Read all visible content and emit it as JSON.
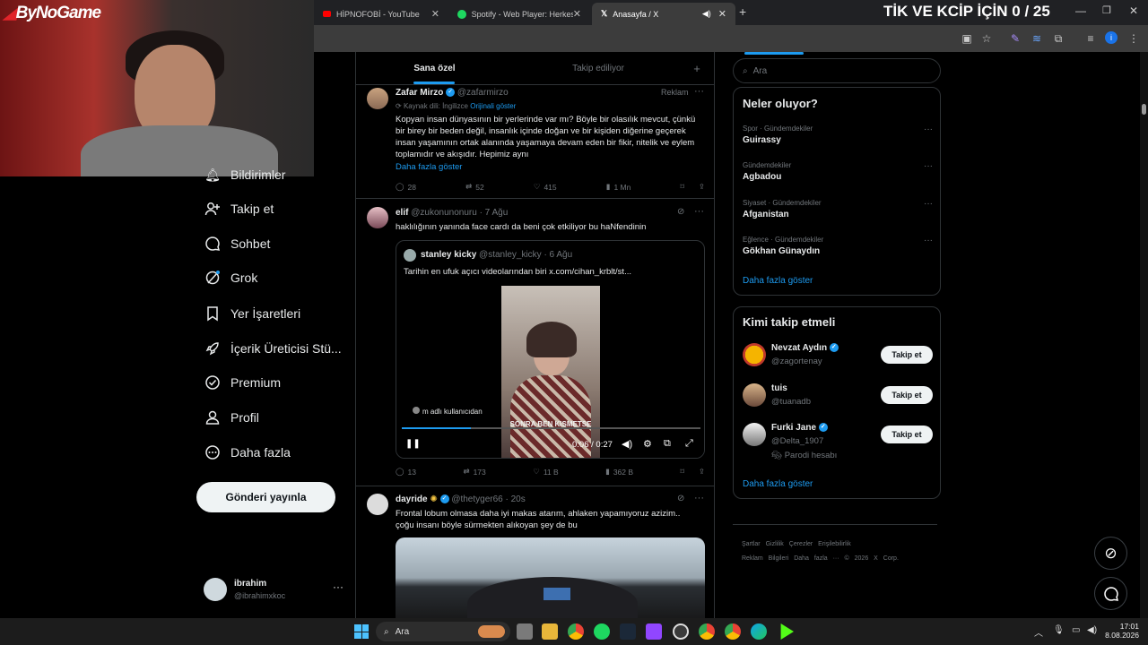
{
  "stream": {
    "logo": "ByNoGame",
    "overlay": "TİK VE KCİP İÇİN 0 / 25"
  },
  "browser": {
    "tabs": [
      {
        "label": "HİPNOFOBİ - YouTube"
      },
      {
        "label": "Spotify - Web Player: Herkes iç"
      },
      {
        "label": "Anasayfa / X"
      }
    ]
  },
  "sidebar": {
    "items": [
      {
        "label": "Bildirimler"
      },
      {
        "label": "Takip et"
      },
      {
        "label": "Sohbet"
      },
      {
        "label": "Grok"
      },
      {
        "label": "Yer İşaretleri"
      },
      {
        "label": "İçerik Üreticisi Stü..."
      },
      {
        "label": "Premium"
      },
      {
        "label": "Profil"
      },
      {
        "label": "Daha fazla"
      }
    ],
    "post_button": "Gönderi yayınla",
    "user": {
      "name": "ibrahim",
      "handle": "@ibrahimxkoc"
    }
  },
  "feed": {
    "tabs": [
      "Sana özel",
      "Takip ediliyor"
    ],
    "posts": [
      {
        "name": "Zafar Mirzo",
        "handle": "@zafarmirzo",
        "badge": "Reklam",
        "source": "Kaynak dili: İngilizce",
        "source_link": "Orijinali göster",
        "text": "Kopyan insan dünyasının bir yerlerinde var mı? Böyle bir olasılık mevcut, çünkü bir birey bir beden değil, insanlık içinde doğan ve bir kişiden diğerine geçerek insan yaşamının ortak alanında yaşamaya devam eden bir fikir, nitelik ve eylem toplamıdır ve akışıdır. Hepimiz aynı",
        "more": "Daha fazla göster",
        "replies": "28",
        "reposts": "52",
        "likes": "415",
        "views": "1 Mn"
      },
      {
        "name": "elif",
        "handle": "@zukonunonuru",
        "time": "· 7 Ağu",
        "text": "haklılığının yanında face cardı da beni çok etkiliyor bu haNfendinin",
        "quote": {
          "name": "stanley kicky",
          "handle": "@stanley_kicky",
          "time": "· 6 Ağu",
          "text": "Tarihin en ufuk açıcı videolarından biri  x.com/cihan_krblt/st..."
        },
        "video": {
          "from": "m adlı kullanıcıdan",
          "caption": "SONRA BEN KISMETSE",
          "time": "0:06 / 0:27",
          "progress": 0.23
        },
        "replies": "13",
        "reposts": "173",
        "likes": "11 B",
        "views": "362 B"
      },
      {
        "name": "dayride",
        "handle": "@thetyger66",
        "time": "· 20s",
        "text": "Frontal lobum olmasa daha iyi makas atarım, ahlaken yapamıyoruz azizim.. çoğu insanı böyle sürmekten alıkoyan şey de bu"
      }
    ]
  },
  "right": {
    "search_placeholder": "Ara",
    "trends_title": "Neler oluyor?",
    "trends": [
      {
        "category": "Spor · Gündemdekiler",
        "name": "Guirassy"
      },
      {
        "category": "Gündemdekiler",
        "name": "Agbadou"
      },
      {
        "category": "Siyaset · Gündemdekiler",
        "name": "Afganistan"
      },
      {
        "category": "Eğlence · Gündemdekiler",
        "name": "Gökhan Günaydın"
      }
    ],
    "trends_more": "Daha fazla göster",
    "who_title": "Kimi takip etmeli",
    "who": [
      {
        "name": "Nevzat Aydın",
        "handle": "@zagortenay",
        "button": "Takip et"
      },
      {
        "name": "tuis",
        "handle": "@tuanadb",
        "button": "Takip et"
      },
      {
        "name": "Furki Jane",
        "handle": "@Delta_1907",
        "note": "Parodi hesabı",
        "button": "Takip et"
      }
    ],
    "who_more": "Daha fazla göster",
    "footer": [
      "Şartlar",
      "Gizlilik",
      "Çerezler",
      "Erişilebilirlik",
      "Reklam Bilgileri",
      "Daha fazla ···",
      "© 2026 X Corp."
    ]
  },
  "taskbar": {
    "search": "Ara",
    "time": "17:01",
    "date": "8.08.2026"
  }
}
